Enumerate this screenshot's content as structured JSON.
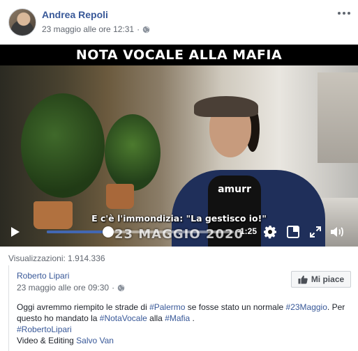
{
  "post": {
    "author": "Andrea Repoli",
    "timestamp": "23 maggio alle ore 12:31",
    "privacy_icon": "globe-icon",
    "more_icon": "more-options-icon"
  },
  "video": {
    "title_banner": "NOTA VOCALE ALLA MAFIA",
    "shirt_text": "amurr",
    "subtitle": "E c'è l'immondizia: \"La gestisco io!\"",
    "date_overlay": "23 MAGGIO 2020",
    "time_remaining": "-1:25",
    "progress": 0.33,
    "accent_color": "#4267b2"
  },
  "views": {
    "text": "Visualizzazioni: 1.914.336"
  },
  "shared_post": {
    "author": "Roberto Lipari",
    "timestamp": "23 maggio alle ore 09:30",
    "like_label": "Mi piace",
    "body": {
      "t1": "Oggi avremmo riempito le strade di ",
      "tag1": "#Palermo",
      "t2": " se fosse stato un normale ",
      "tag2": "#23Maggio",
      "t3": ". Per questo ho mandato la ",
      "tag3": "#NotaVocale",
      "t4": " alla ",
      "tag4": "#Mafia",
      "t5": " .",
      "tag5": "#RobertoLipari",
      "credit_prefix": "Video & Editing ",
      "credit_name": "Salvo Van"
    }
  }
}
